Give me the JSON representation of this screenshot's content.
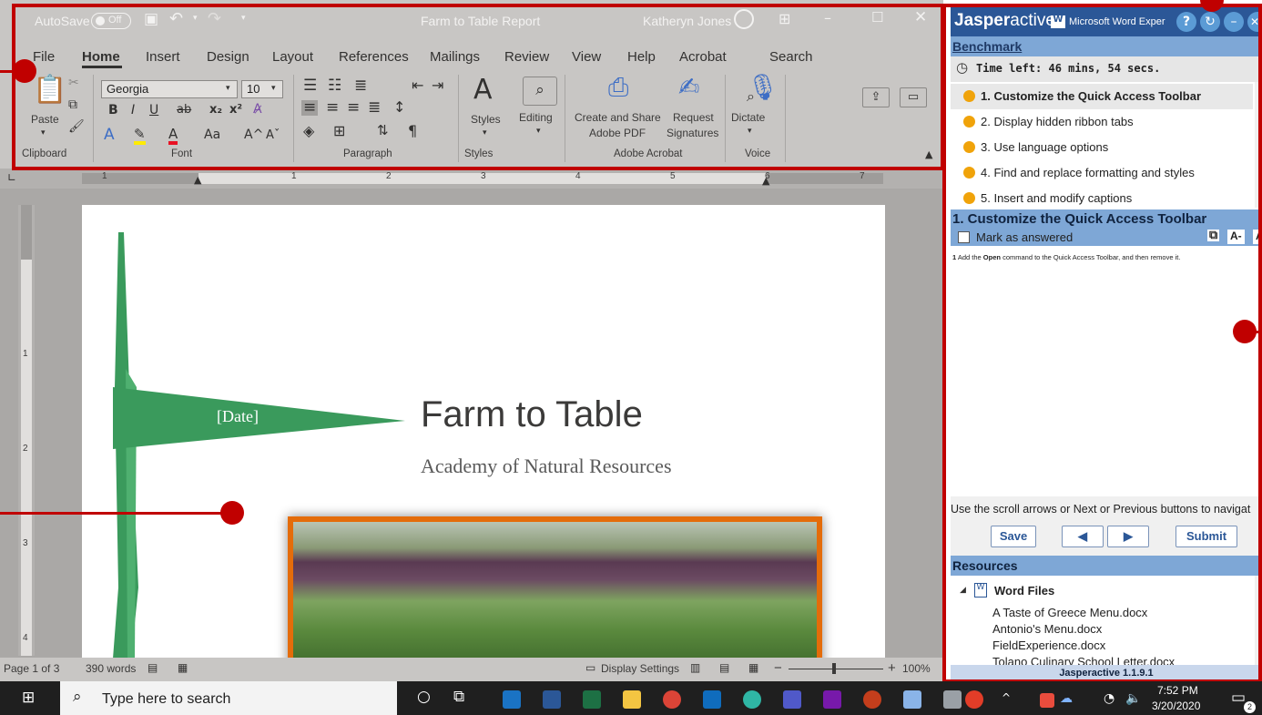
{
  "word": {
    "autosave_label": "AutoSave",
    "autosave_state": "Off",
    "doc_title": "Farm to Table Report",
    "user_name": "Katheryn Jones",
    "menu": [
      "File",
      "Home",
      "Insert",
      "Design",
      "Layout",
      "References",
      "Mailings",
      "Review",
      "View",
      "Help",
      "Acrobat"
    ],
    "search_label": "Search",
    "font_name": "Georgia",
    "font_size": "10",
    "paste_label": "Paste",
    "styles_label": "Styles",
    "editing_label": "Editing",
    "acrobat_create_label1": "Create and Share",
    "acrobat_create_label2": "Adobe PDF",
    "acrobat_request_label1": "Request",
    "acrobat_request_label2": "Signatures",
    "dictate_label": "Dictate",
    "groups": [
      "Clipboard",
      "Font",
      "Paragraph",
      "Styles",
      "Adobe Acrobat",
      "Voice"
    ],
    "ruler_numbers": [
      "1",
      "1",
      "2",
      "3",
      "4",
      "5",
      "6",
      "7"
    ],
    "vruler_numbers": [
      "1",
      "2",
      "3",
      "4"
    ],
    "status_page": "Page 1 of 3",
    "status_words": "390 words",
    "display_settings": "Display Settings",
    "zoom": "100%",
    "zoom_minus": "−",
    "zoom_plus": "+",
    "doc_date": "[Date]",
    "doc_heading": "Farm to Table",
    "doc_subheading": "Academy of Natural Resources"
  },
  "jasper": {
    "brand1": "Jasper",
    "brand2": "active",
    "app_label": "Microsoft Word Exper",
    "help_glyph": "?",
    "benchmark": "Benchmark",
    "time_left": "Time left: 46 mins, 54 secs.",
    "tasks": [
      "1. Customize the Quick Access Toolbar",
      "2. Display hidden ribbon tabs",
      "3. Use language options",
      "4. Find and replace formatting and styles",
      "5. Insert and modify captions"
    ],
    "task_heading": "1. Customize the Quick Access Toolbar",
    "mark_answered": "Mark as answered",
    "font_minus": "A-",
    "font_plus": "A",
    "instruction_num": "1",
    "instruction_pre": "Add the",
    "instruction_bold": "Open",
    "instruction_post": "command to the Quick Access Toolbar, and then remove it.",
    "nav_hint": "Use the scroll arrows or Next or Previous buttons to navigat",
    "save": "Save",
    "prev_glyph": "◀",
    "next_glyph": "▶",
    "submit": "Submit",
    "resources": "Resources",
    "word_files": "Word Files",
    "files": [
      "A Taste of Greece Menu.docx",
      "Antonio's Menu.docx",
      "FieldExperience.docx",
      "Tolano Culinary School Letter.docx"
    ],
    "version": "Jasperactive 1.1.9.1"
  },
  "taskbar": {
    "search_placeholder": "Type here to search",
    "time": "7:52 PM",
    "date": "3/20/2020",
    "notifications": "2"
  },
  "colors": {
    "annotation_red": "#c00000",
    "jasper_blue": "#2b5797",
    "jasper_section": "#7ea7d6",
    "doc_green": "#3a9a5c"
  }
}
